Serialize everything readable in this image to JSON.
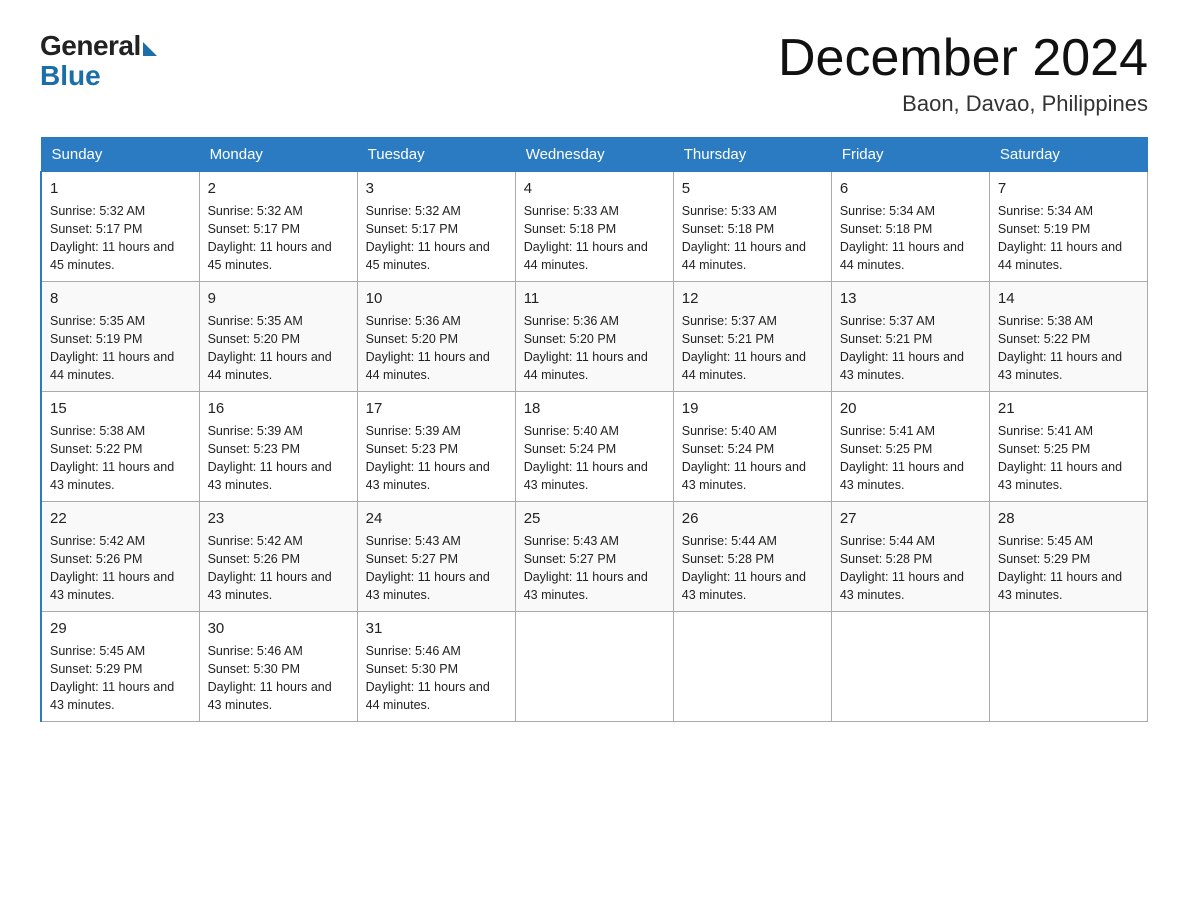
{
  "header": {
    "logo_general": "General",
    "logo_blue": "Blue",
    "month_title": "December 2024",
    "location": "Baon, Davao, Philippines"
  },
  "weekdays": [
    "Sunday",
    "Monday",
    "Tuesday",
    "Wednesday",
    "Thursday",
    "Friday",
    "Saturday"
  ],
  "weeks": [
    [
      {
        "day": "1",
        "sunrise": "5:32 AM",
        "sunset": "5:17 PM",
        "daylight": "11 hours and 45 minutes."
      },
      {
        "day": "2",
        "sunrise": "5:32 AM",
        "sunset": "5:17 PM",
        "daylight": "11 hours and 45 minutes."
      },
      {
        "day": "3",
        "sunrise": "5:32 AM",
        "sunset": "5:17 PM",
        "daylight": "11 hours and 45 minutes."
      },
      {
        "day": "4",
        "sunrise": "5:33 AM",
        "sunset": "5:18 PM",
        "daylight": "11 hours and 44 minutes."
      },
      {
        "day": "5",
        "sunrise": "5:33 AM",
        "sunset": "5:18 PM",
        "daylight": "11 hours and 44 minutes."
      },
      {
        "day": "6",
        "sunrise": "5:34 AM",
        "sunset": "5:18 PM",
        "daylight": "11 hours and 44 minutes."
      },
      {
        "day": "7",
        "sunrise": "5:34 AM",
        "sunset": "5:19 PM",
        "daylight": "11 hours and 44 minutes."
      }
    ],
    [
      {
        "day": "8",
        "sunrise": "5:35 AM",
        "sunset": "5:19 PM",
        "daylight": "11 hours and 44 minutes."
      },
      {
        "day": "9",
        "sunrise": "5:35 AM",
        "sunset": "5:20 PM",
        "daylight": "11 hours and 44 minutes."
      },
      {
        "day": "10",
        "sunrise": "5:36 AM",
        "sunset": "5:20 PM",
        "daylight": "11 hours and 44 minutes."
      },
      {
        "day": "11",
        "sunrise": "5:36 AM",
        "sunset": "5:20 PM",
        "daylight": "11 hours and 44 minutes."
      },
      {
        "day": "12",
        "sunrise": "5:37 AM",
        "sunset": "5:21 PM",
        "daylight": "11 hours and 44 minutes."
      },
      {
        "day": "13",
        "sunrise": "5:37 AM",
        "sunset": "5:21 PM",
        "daylight": "11 hours and 43 minutes."
      },
      {
        "day": "14",
        "sunrise": "5:38 AM",
        "sunset": "5:22 PM",
        "daylight": "11 hours and 43 minutes."
      }
    ],
    [
      {
        "day": "15",
        "sunrise": "5:38 AM",
        "sunset": "5:22 PM",
        "daylight": "11 hours and 43 minutes."
      },
      {
        "day": "16",
        "sunrise": "5:39 AM",
        "sunset": "5:23 PM",
        "daylight": "11 hours and 43 minutes."
      },
      {
        "day": "17",
        "sunrise": "5:39 AM",
        "sunset": "5:23 PM",
        "daylight": "11 hours and 43 minutes."
      },
      {
        "day": "18",
        "sunrise": "5:40 AM",
        "sunset": "5:24 PM",
        "daylight": "11 hours and 43 minutes."
      },
      {
        "day": "19",
        "sunrise": "5:40 AM",
        "sunset": "5:24 PM",
        "daylight": "11 hours and 43 minutes."
      },
      {
        "day": "20",
        "sunrise": "5:41 AM",
        "sunset": "5:25 PM",
        "daylight": "11 hours and 43 minutes."
      },
      {
        "day": "21",
        "sunrise": "5:41 AM",
        "sunset": "5:25 PM",
        "daylight": "11 hours and 43 minutes."
      }
    ],
    [
      {
        "day": "22",
        "sunrise": "5:42 AM",
        "sunset": "5:26 PM",
        "daylight": "11 hours and 43 minutes."
      },
      {
        "day": "23",
        "sunrise": "5:42 AM",
        "sunset": "5:26 PM",
        "daylight": "11 hours and 43 minutes."
      },
      {
        "day": "24",
        "sunrise": "5:43 AM",
        "sunset": "5:27 PM",
        "daylight": "11 hours and 43 minutes."
      },
      {
        "day": "25",
        "sunrise": "5:43 AM",
        "sunset": "5:27 PM",
        "daylight": "11 hours and 43 minutes."
      },
      {
        "day": "26",
        "sunrise": "5:44 AM",
        "sunset": "5:28 PM",
        "daylight": "11 hours and 43 minutes."
      },
      {
        "day": "27",
        "sunrise": "5:44 AM",
        "sunset": "5:28 PM",
        "daylight": "11 hours and 43 minutes."
      },
      {
        "day": "28",
        "sunrise": "5:45 AM",
        "sunset": "5:29 PM",
        "daylight": "11 hours and 43 minutes."
      }
    ],
    [
      {
        "day": "29",
        "sunrise": "5:45 AM",
        "sunset": "5:29 PM",
        "daylight": "11 hours and 43 minutes."
      },
      {
        "day": "30",
        "sunrise": "5:46 AM",
        "sunset": "5:30 PM",
        "daylight": "11 hours and 43 minutes."
      },
      {
        "day": "31",
        "sunrise": "5:46 AM",
        "sunset": "5:30 PM",
        "daylight": "11 hours and 44 minutes."
      },
      null,
      null,
      null,
      null
    ]
  ]
}
